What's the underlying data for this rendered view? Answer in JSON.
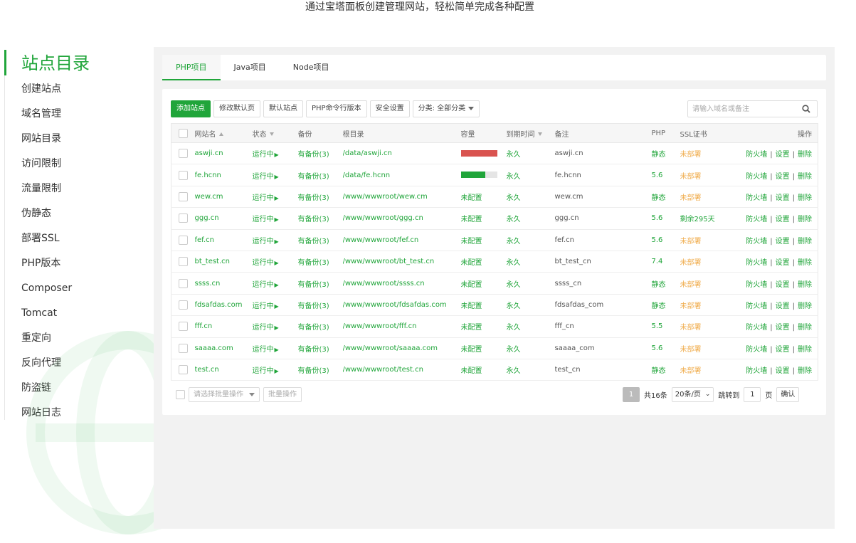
{
  "caption": "通过宝塔面板创建管理网站，轻松简单完成各种配置",
  "sidebar": {
    "title": "站点目录",
    "items": [
      "创建站点",
      "域名管理",
      "网站目录",
      "访问限制",
      "流量限制",
      "伪静态",
      "部署SSL",
      "PHP版本",
      "Composer",
      "Tomcat",
      "重定向",
      "反向代理",
      "防盗链",
      "网站日志"
    ]
  },
  "tabs": [
    {
      "label": "PHP项目",
      "active": true
    },
    {
      "label": "Java项目",
      "active": false
    },
    {
      "label": "Node项目",
      "active": false
    }
  ],
  "toolbar": {
    "add": "添加站点",
    "default_page": "修改默认页",
    "default_site": "默认站点",
    "php_cli": "PHP命令行版本",
    "security": "安全设置",
    "category": "分类: 全部分类"
  },
  "search": {
    "placeholder": "请输入域名或备注"
  },
  "table": {
    "headers": {
      "name": "网站名",
      "status": "状态",
      "backup": "备份",
      "root": "根目录",
      "capacity": "容量",
      "expire": "到期时间",
      "remark": "备注",
      "php": "PHP",
      "ssl": "SSL证书",
      "ops": "操作"
    },
    "ops": {
      "firewall": "防火墙",
      "settings": "设置",
      "delete": "删除"
    },
    "rows": [
      {
        "name": "aswji.cn",
        "status": "运行中",
        "backup": "有备份(3)",
        "root": "/data/aswji.cn",
        "capacity": "",
        "usage": 1.0,
        "bar_color": "#d9534f",
        "expire": "永久",
        "remark": "aswji.cn",
        "php": "静态",
        "ssl": "未部署"
      },
      {
        "name": "fe.hcnn",
        "status": "运行中",
        "backup": "有备份(3)",
        "root": "/data/fe.hcnn",
        "capacity": "",
        "usage": 0.67,
        "bar_color": "#20a53a",
        "expire": "永久",
        "remark": "fe.hcnn",
        "php": "5.6",
        "ssl": "未部署"
      },
      {
        "name": "wew.cm",
        "status": "运行中",
        "backup": "有备份(3)",
        "root": "/www/wwwroot/wew.cm",
        "capacity": "未配置",
        "usage": null,
        "bar_color": "",
        "expire": "永久",
        "remark": "wew.cm",
        "php": "静态",
        "ssl": "未部署"
      },
      {
        "name": "ggg.cn",
        "status": "运行中",
        "backup": "有备份(3)",
        "root": "/www/wwwroot/ggg.cn",
        "capacity": "未配置",
        "usage": null,
        "bar_color": "",
        "expire": "永久",
        "remark": "ggg.cn",
        "php": "5.6",
        "ssl": "剩余295天"
      },
      {
        "name": "fef.cn",
        "status": "运行中",
        "backup": "有备份(3)",
        "root": "/www/wwwroot/fef.cn",
        "capacity": "未配置",
        "usage": null,
        "bar_color": "",
        "expire": "永久",
        "remark": "fef.cn",
        "php": "5.6",
        "ssl": "未部署"
      },
      {
        "name": "bt_test.cn",
        "status": "运行中",
        "backup": "有备份(3)",
        "root": "/www/wwwroot/bt_test.cn",
        "capacity": "未配置",
        "usage": null,
        "bar_color": "",
        "expire": "永久",
        "remark": "bt_test_cn",
        "php": "7.4",
        "ssl": "未部署"
      },
      {
        "name": "ssss.cn",
        "status": "运行中",
        "backup": "有备份(3)",
        "root": "/www/wwwroot/ssss.cn",
        "capacity": "未配置",
        "usage": null,
        "bar_color": "",
        "expire": "永久",
        "remark": "ssss_cn",
        "php": "静态",
        "ssl": "未部署"
      },
      {
        "name": "fdsafdas.com",
        "status": "运行中",
        "backup": "有备份(3)",
        "root": "/www/wwwroot/fdsafdas.com",
        "capacity": "未配置",
        "usage": null,
        "bar_color": "",
        "expire": "永久",
        "remark": "fdsafdas_com",
        "php": "静态",
        "ssl": "未部署"
      },
      {
        "name": "fff.cn",
        "status": "运行中",
        "backup": "有备份(3)",
        "root": "/www/wwwroot/fff.cn",
        "capacity": "未配置",
        "usage": null,
        "bar_color": "",
        "expire": "永久",
        "remark": "fff_cn",
        "php": "5.5",
        "ssl": "未部署"
      },
      {
        "name": "saaaa.com",
        "status": "运行中",
        "backup": "有备份(3)",
        "root": "/www/wwwroot/saaaa.com",
        "capacity": "未配置",
        "usage": null,
        "bar_color": "",
        "expire": "永久",
        "remark": "saaaa_com",
        "php": "5.6",
        "ssl": "未部署"
      },
      {
        "name": "test.cn",
        "status": "运行中",
        "backup": "有备份(3)",
        "root": "/www/wwwroot/test.cn",
        "capacity": "未配置",
        "usage": null,
        "bar_color": "",
        "expire": "永久",
        "remark": "test_cn",
        "php": "静态",
        "ssl": "未部署"
      }
    ]
  },
  "footer": {
    "batch_placeholder": "请选择批量操作",
    "batch_button": "批量操作",
    "current_page": "1",
    "total": "共16条",
    "per_page": "20条/页",
    "jump_label": "跳转到",
    "jump_value": "1",
    "page_unit": "页",
    "confirm": "确认"
  },
  "colors": {
    "accent": "#20a53a",
    "warning": "#f0ad4e",
    "danger": "#d9534f",
    "panel_bg": "#f2f2f2"
  }
}
